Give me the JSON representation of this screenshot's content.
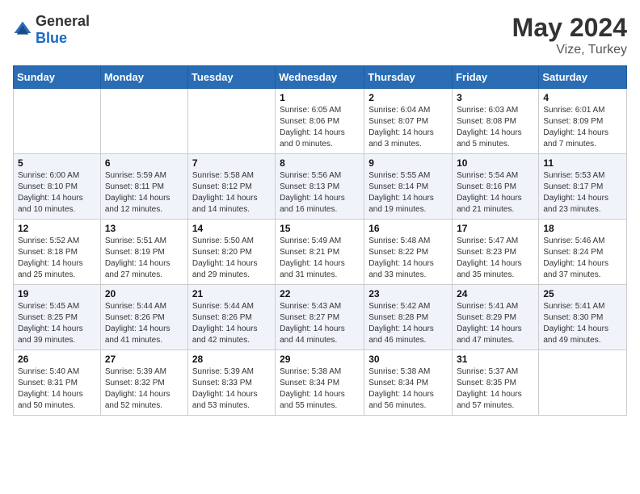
{
  "header": {
    "logo_general": "General",
    "logo_blue": "Blue",
    "month_title": "May 2024",
    "location": "Vize, Turkey"
  },
  "days_of_week": [
    "Sunday",
    "Monday",
    "Tuesday",
    "Wednesday",
    "Thursday",
    "Friday",
    "Saturday"
  ],
  "weeks": [
    [
      {
        "day": "",
        "info": ""
      },
      {
        "day": "",
        "info": ""
      },
      {
        "day": "",
        "info": ""
      },
      {
        "day": "1",
        "info": "Sunrise: 6:05 AM\nSunset: 8:06 PM\nDaylight: 14 hours\nand 0 minutes."
      },
      {
        "day": "2",
        "info": "Sunrise: 6:04 AM\nSunset: 8:07 PM\nDaylight: 14 hours\nand 3 minutes."
      },
      {
        "day": "3",
        "info": "Sunrise: 6:03 AM\nSunset: 8:08 PM\nDaylight: 14 hours\nand 5 minutes."
      },
      {
        "day": "4",
        "info": "Sunrise: 6:01 AM\nSunset: 8:09 PM\nDaylight: 14 hours\nand 7 minutes."
      }
    ],
    [
      {
        "day": "5",
        "info": "Sunrise: 6:00 AM\nSunset: 8:10 PM\nDaylight: 14 hours\nand 10 minutes."
      },
      {
        "day": "6",
        "info": "Sunrise: 5:59 AM\nSunset: 8:11 PM\nDaylight: 14 hours\nand 12 minutes."
      },
      {
        "day": "7",
        "info": "Sunrise: 5:58 AM\nSunset: 8:12 PM\nDaylight: 14 hours\nand 14 minutes."
      },
      {
        "day": "8",
        "info": "Sunrise: 5:56 AM\nSunset: 8:13 PM\nDaylight: 14 hours\nand 16 minutes."
      },
      {
        "day": "9",
        "info": "Sunrise: 5:55 AM\nSunset: 8:14 PM\nDaylight: 14 hours\nand 19 minutes."
      },
      {
        "day": "10",
        "info": "Sunrise: 5:54 AM\nSunset: 8:16 PM\nDaylight: 14 hours\nand 21 minutes."
      },
      {
        "day": "11",
        "info": "Sunrise: 5:53 AM\nSunset: 8:17 PM\nDaylight: 14 hours\nand 23 minutes."
      }
    ],
    [
      {
        "day": "12",
        "info": "Sunrise: 5:52 AM\nSunset: 8:18 PM\nDaylight: 14 hours\nand 25 minutes."
      },
      {
        "day": "13",
        "info": "Sunrise: 5:51 AM\nSunset: 8:19 PM\nDaylight: 14 hours\nand 27 minutes."
      },
      {
        "day": "14",
        "info": "Sunrise: 5:50 AM\nSunset: 8:20 PM\nDaylight: 14 hours\nand 29 minutes."
      },
      {
        "day": "15",
        "info": "Sunrise: 5:49 AM\nSunset: 8:21 PM\nDaylight: 14 hours\nand 31 minutes."
      },
      {
        "day": "16",
        "info": "Sunrise: 5:48 AM\nSunset: 8:22 PM\nDaylight: 14 hours\nand 33 minutes."
      },
      {
        "day": "17",
        "info": "Sunrise: 5:47 AM\nSunset: 8:23 PM\nDaylight: 14 hours\nand 35 minutes."
      },
      {
        "day": "18",
        "info": "Sunrise: 5:46 AM\nSunset: 8:24 PM\nDaylight: 14 hours\nand 37 minutes."
      }
    ],
    [
      {
        "day": "19",
        "info": "Sunrise: 5:45 AM\nSunset: 8:25 PM\nDaylight: 14 hours\nand 39 minutes."
      },
      {
        "day": "20",
        "info": "Sunrise: 5:44 AM\nSunset: 8:26 PM\nDaylight: 14 hours\nand 41 minutes."
      },
      {
        "day": "21",
        "info": "Sunrise: 5:44 AM\nSunset: 8:26 PM\nDaylight: 14 hours\nand 42 minutes."
      },
      {
        "day": "22",
        "info": "Sunrise: 5:43 AM\nSunset: 8:27 PM\nDaylight: 14 hours\nand 44 minutes."
      },
      {
        "day": "23",
        "info": "Sunrise: 5:42 AM\nSunset: 8:28 PM\nDaylight: 14 hours\nand 46 minutes."
      },
      {
        "day": "24",
        "info": "Sunrise: 5:41 AM\nSunset: 8:29 PM\nDaylight: 14 hours\nand 47 minutes."
      },
      {
        "day": "25",
        "info": "Sunrise: 5:41 AM\nSunset: 8:30 PM\nDaylight: 14 hours\nand 49 minutes."
      }
    ],
    [
      {
        "day": "26",
        "info": "Sunrise: 5:40 AM\nSunset: 8:31 PM\nDaylight: 14 hours\nand 50 minutes."
      },
      {
        "day": "27",
        "info": "Sunrise: 5:39 AM\nSunset: 8:32 PM\nDaylight: 14 hours\nand 52 minutes."
      },
      {
        "day": "28",
        "info": "Sunrise: 5:39 AM\nSunset: 8:33 PM\nDaylight: 14 hours\nand 53 minutes."
      },
      {
        "day": "29",
        "info": "Sunrise: 5:38 AM\nSunset: 8:34 PM\nDaylight: 14 hours\nand 55 minutes."
      },
      {
        "day": "30",
        "info": "Sunrise: 5:38 AM\nSunset: 8:34 PM\nDaylight: 14 hours\nand 56 minutes."
      },
      {
        "day": "31",
        "info": "Sunrise: 5:37 AM\nSunset: 8:35 PM\nDaylight: 14 hours\nand 57 minutes."
      },
      {
        "day": "",
        "info": ""
      }
    ]
  ]
}
